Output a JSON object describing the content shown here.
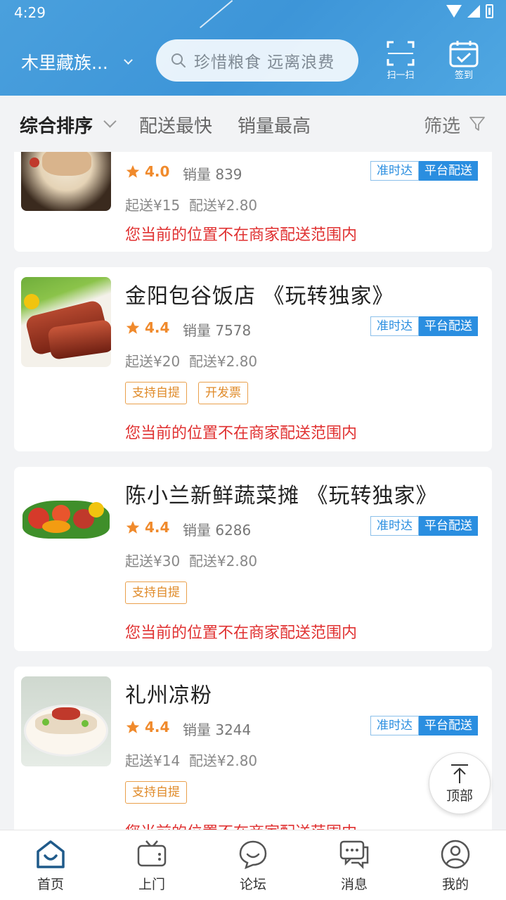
{
  "status": {
    "time": "4:29"
  },
  "header": {
    "location": "木里藏族...",
    "search_placeholder": "珍惜粮食 远离浪费",
    "scan_label": "扫一扫",
    "checkin_label": "签到"
  },
  "filters": {
    "sort": "综合排序",
    "fastest": "配送最快",
    "top_sales": "销量最高",
    "filter": "筛选"
  },
  "shops": [
    {
      "name": "",
      "rating": "4.0",
      "sales": "销量 839",
      "min_order": "起送¥15",
      "delivery_fee": "配送¥2.80",
      "tag_ontime": "准时达",
      "tag_platform": "平台配送",
      "badges": [],
      "warning": "您当前的位置不在商家配送范围内"
    },
    {
      "name": "金阳包谷饭店 《玩转独家》",
      "rating": "4.4",
      "sales": "销量 7578",
      "min_order": "起送¥20",
      "delivery_fee": "配送¥2.80",
      "tag_ontime": "准时达",
      "tag_platform": "平台配送",
      "badges": [
        "支持自提",
        "开发票"
      ],
      "warning": "您当前的位置不在商家配送范围内"
    },
    {
      "name": "陈小兰新鲜蔬菜摊 《玩转独家》",
      "rating": "4.4",
      "sales": "销量 6286",
      "min_order": "起送¥30",
      "delivery_fee": "配送¥2.80",
      "tag_ontime": "准时达",
      "tag_platform": "平台配送",
      "badges": [
        "支持自提"
      ],
      "warning": "您当前的位置不在商家配送范围内"
    },
    {
      "name": "礼州凉粉",
      "rating": "4.4",
      "sales": "销量 3244",
      "min_order": "起送¥14",
      "delivery_fee": "配送¥2.80",
      "tag_ontime": "准时达",
      "tag_platform": "平台配送",
      "badges": [
        "支持自提"
      ],
      "warning": "您当前的位置不在商家配送范围内"
    }
  ],
  "back_to_top": "顶部",
  "nav": {
    "home": "首页",
    "visit": "上门",
    "forum": "论坛",
    "messages": "消息",
    "mine": "我的"
  },
  "colors": {
    "header_blue": "#3d95d8",
    "accent_blue": "#2a8ee0",
    "warning_red": "#e03131",
    "badge_orange": "#e08b2a",
    "rating_orange": "#f08a2c"
  },
  "icons": [
    "search-icon",
    "scan-icon",
    "calendar-check-icon",
    "star-icon",
    "arrow-up-icon",
    "home-icon",
    "tv-icon",
    "smile-chat-icon",
    "message-icon",
    "user-icon"
  ]
}
